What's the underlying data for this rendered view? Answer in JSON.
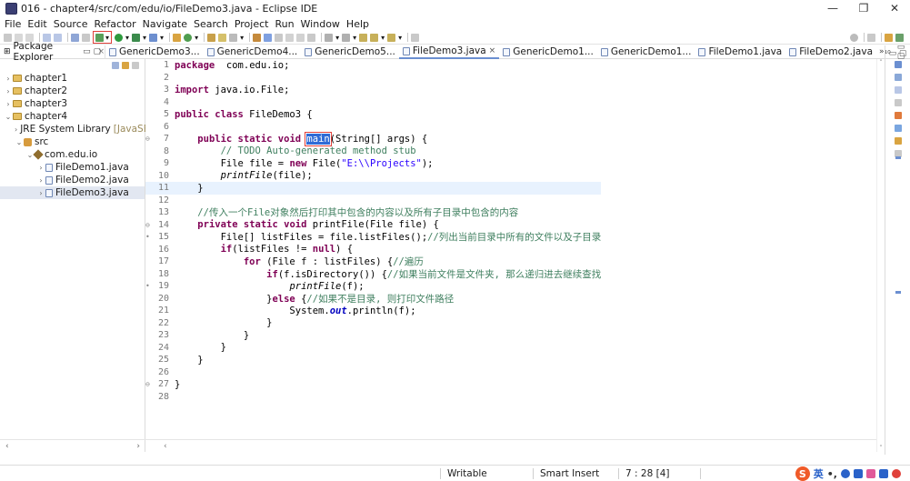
{
  "window": {
    "title": "016 - chapter4/src/com/edu/io/FileDemo3.java - Eclipse IDE",
    "min": "—",
    "restore": "❐",
    "close": "✕"
  },
  "menu": [
    "File",
    "Edit",
    "Source",
    "Refactor",
    "Navigate",
    "Search",
    "Project",
    "Run",
    "Window",
    "Help"
  ],
  "package_explorer": {
    "title": "Package Explorer",
    "close": "×",
    "tree": [
      {
        "label": "chapter1",
        "indent": 0,
        "twisty": "›",
        "icon": "project"
      },
      {
        "label": "chapter2",
        "indent": 0,
        "twisty": "›",
        "icon": "project"
      },
      {
        "label": "chapter3",
        "indent": 0,
        "twisty": "›",
        "icon": "project"
      },
      {
        "label": "chapter4",
        "indent": 0,
        "twisty": "⌄",
        "icon": "project"
      },
      {
        "label": "JRE System Library",
        "suffix": "[JavaSE",
        "indent": 1,
        "twisty": "›",
        "icon": "library"
      },
      {
        "label": "src",
        "indent": 1,
        "twisty": "⌄",
        "icon": "source-folder"
      },
      {
        "label": "com.edu.io",
        "indent": 2,
        "twisty": "⌄",
        "icon": "package"
      },
      {
        "label": "FileDemo1.java",
        "indent": 3,
        "twisty": "›",
        "icon": "java-file"
      },
      {
        "label": "FileDemo2.java",
        "indent": 3,
        "twisty": "›",
        "icon": "java-file"
      },
      {
        "label": "FileDemo3.java",
        "indent": 3,
        "twisty": "›",
        "icon": "java-file",
        "selected": true
      }
    ]
  },
  "editor_tabs": [
    {
      "label": "GenericDemo3..."
    },
    {
      "label": "GenericDemo4..."
    },
    {
      "label": "GenericDemo5..."
    },
    {
      "label": "FileDemo3.java",
      "active": true
    },
    {
      "label": "GenericDemo1..."
    },
    {
      "label": "GenericDemo1..."
    },
    {
      "label": "FileDemo1.java"
    },
    {
      "label": "FileDemo2.java"
    }
  ],
  "tabs_overflow": "»₁₀",
  "code": [
    {
      "n": "1",
      "tokens": [
        [
          "kw",
          "package"
        ],
        [
          "",
          "  com.edu.io;"
        ]
      ]
    },
    {
      "n": "2",
      "tokens": []
    },
    {
      "n": "3",
      "tokens": [
        [
          "kw",
          "import"
        ],
        [
          "",
          " java.io.File;"
        ]
      ]
    },
    {
      "n": "4",
      "tokens": []
    },
    {
      "n": "5",
      "tokens": [
        [
          "kw",
          "public class"
        ],
        [
          "",
          " FileDemo3 {"
        ]
      ]
    },
    {
      "n": "6",
      "tokens": []
    },
    {
      "n": "7",
      "mark": "⊖",
      "tokens": [
        [
          "",
          "    "
        ],
        [
          "kw",
          "public static void"
        ],
        [
          "",
          " "
        ],
        [
          "hl",
          "main"
        ],
        [
          "",
          "(String[] args) {"
        ]
      ]
    },
    {
      "n": "8",
      "tokens": [
        [
          "",
          "        "
        ],
        [
          "cm",
          "// TODO Auto-generated method stub"
        ]
      ]
    },
    {
      "n": "9",
      "tokens": [
        [
          "",
          "        File file = "
        ],
        [
          "kw",
          "new"
        ],
        [
          "",
          " File("
        ],
        [
          "str",
          "\"E:\\\\Projects\""
        ],
        [
          "",
          ");"
        ]
      ]
    },
    {
      "n": "10",
      "tokens": [
        [
          "",
          "        "
        ],
        [
          "it",
          "printFile"
        ],
        [
          "",
          "(file);"
        ]
      ]
    },
    {
      "n": "11",
      "current": true,
      "tokens": [
        [
          "",
          "    }"
        ]
      ]
    },
    {
      "n": "12",
      "tokens": []
    },
    {
      "n": "13",
      "tokens": [
        [
          "",
          "    "
        ],
        [
          "cm",
          "//传入一个File对象然后打印其中包含的内容以及所有子目录中包含的内容"
        ]
      ]
    },
    {
      "n": "14",
      "mark": "⊖",
      "tokens": [
        [
          "",
          "    "
        ],
        [
          "kw",
          "private static void"
        ],
        [
          "",
          " printFile(File file) {"
        ]
      ]
    },
    {
      "n": "15",
      "mark": "•",
      "tokens": [
        [
          "",
          "        File[] listFiles = file.listFiles();"
        ],
        [
          "cm",
          "//列出当前目录中所有的文件以及子目录"
        ]
      ]
    },
    {
      "n": "16",
      "tokens": [
        [
          "",
          "        "
        ],
        [
          "kw",
          "if"
        ],
        [
          "",
          "(listFiles != "
        ],
        [
          "kw",
          "null"
        ],
        [
          "",
          ") {"
        ]
      ]
    },
    {
      "n": "17",
      "tokens": [
        [
          "",
          "            "
        ],
        [
          "kw",
          "for"
        ],
        [
          "",
          " (File f : listFiles) {"
        ],
        [
          "cm",
          "//遍历"
        ]
      ]
    },
    {
      "n": "18",
      "tokens": [
        [
          "",
          "                "
        ],
        [
          "kw",
          "if"
        ],
        [
          "",
          "(f.isDirectory()) {"
        ],
        [
          "cm",
          "//如果当前文件是文件夹, 那么递归进去继续查找"
        ]
      ]
    },
    {
      "n": "19",
      "mark": "•",
      "tokens": [
        [
          "",
          "                    "
        ],
        [
          "it",
          "printFile"
        ],
        [
          "",
          "(f);"
        ]
      ]
    },
    {
      "n": "20",
      "tokens": [
        [
          "",
          "                }"
        ],
        [
          "kw",
          "else"
        ],
        [
          "",
          " {"
        ],
        [
          "cm",
          "//如果不是目录, 则打印文件路径"
        ]
      ]
    },
    {
      "n": "21",
      "tokens": [
        [
          "",
          "                    System."
        ],
        [
          "fld",
          "out"
        ],
        [
          "",
          ".println(f);"
        ]
      ]
    },
    {
      "n": "22",
      "tokens": [
        [
          "",
          "                }"
        ]
      ]
    },
    {
      "n": "23",
      "tokens": [
        [
          "",
          "            }"
        ]
      ]
    },
    {
      "n": "24",
      "tokens": [
        [
          "",
          "        }"
        ]
      ]
    },
    {
      "n": "25",
      "tokens": [
        [
          "",
          "    }"
        ]
      ]
    },
    {
      "n": "26",
      "tokens": []
    },
    {
      "n": "27",
      "mark": "⊖",
      "tokens": [
        [
          "",
          "}"
        ]
      ]
    },
    {
      "n": "28",
      "tokens": []
    }
  ],
  "status": {
    "writable": "Writable",
    "insert_mode": "Smart Insert",
    "position": "7 : 28 [4]"
  },
  "ime": {
    "logo": "S",
    "lang": "英",
    "punct": "•,"
  },
  "icons": {
    "accent": "#6b8fd1",
    "highlight_box": "#e0403a"
  }
}
